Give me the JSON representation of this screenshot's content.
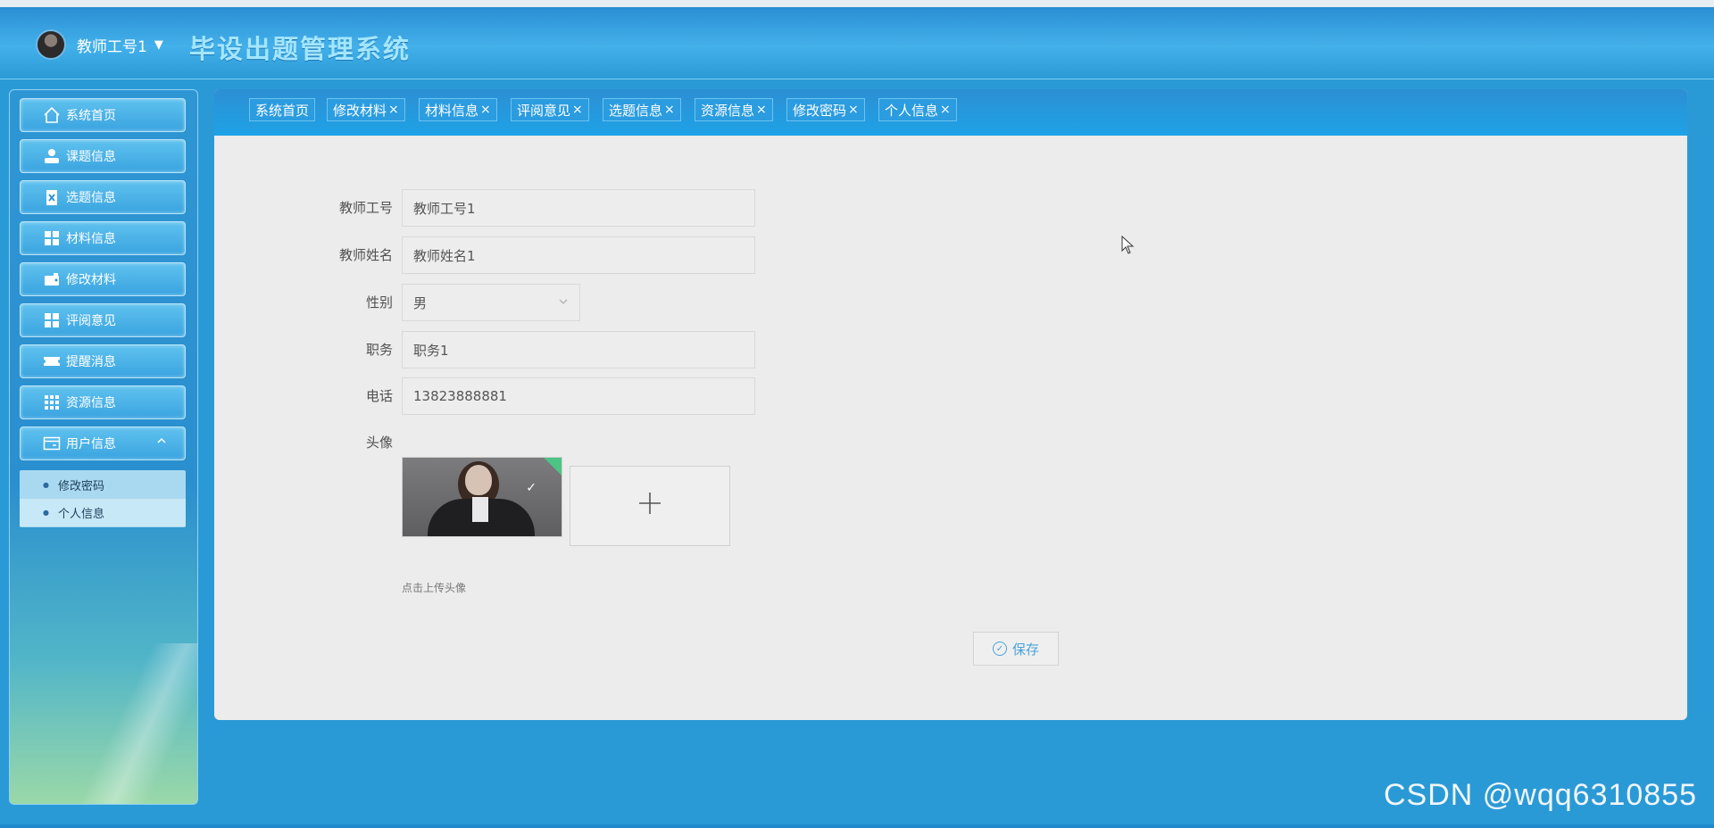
{
  "header": {
    "user_name": "教师工号1",
    "system_title": "毕设出题管理系统"
  },
  "sidebar": {
    "items": [
      {
        "label": "系统首页",
        "icon": "home-icon"
      },
      {
        "label": "课题信息",
        "icon": "user-icon"
      },
      {
        "label": "选题信息",
        "icon": "clipboard-icon"
      },
      {
        "label": "材料信息",
        "icon": "grid-icon"
      },
      {
        "label": "修改材料",
        "icon": "wallet-icon"
      },
      {
        "label": "评阅意见",
        "icon": "grid-icon"
      },
      {
        "label": "提醒消息",
        "icon": "ticket-icon"
      },
      {
        "label": "资源信息",
        "icon": "apps-icon"
      },
      {
        "label": "用户信息",
        "icon": "card-icon"
      }
    ],
    "submenu": [
      {
        "label": "修改密码"
      },
      {
        "label": "个人信息"
      }
    ]
  },
  "tabs": [
    {
      "label": "系统首页",
      "closable": false
    },
    {
      "label": "修改材料",
      "closable": true
    },
    {
      "label": "材料信息",
      "closable": true
    },
    {
      "label": "评阅意见",
      "closable": true
    },
    {
      "label": "选题信息",
      "closable": true
    },
    {
      "label": "资源信息",
      "closable": true
    },
    {
      "label": "修改密码",
      "closable": true
    },
    {
      "label": "个人信息",
      "closable": true
    }
  ],
  "tab_close_glyph": "×",
  "form": {
    "teacher_id": {
      "label": "教师工号",
      "value": "教师工号1"
    },
    "teacher_name": {
      "label": "教师姓名",
      "value": "教师姓名1"
    },
    "gender": {
      "label": "性别",
      "value": "男"
    },
    "position": {
      "label": "职务",
      "value": "职务1"
    },
    "phone": {
      "label": "电话",
      "value": "13823888881"
    },
    "avatar": {
      "label": "头像",
      "hint": "点击上传头像"
    },
    "save_label": "保存"
  },
  "watermark": "CSDN @wqq6310855",
  "colors": {
    "background": "#2a9ad6",
    "content_bg": "#ececec",
    "accent": "#4aa3d8",
    "upload_success": "#4cc483"
  }
}
